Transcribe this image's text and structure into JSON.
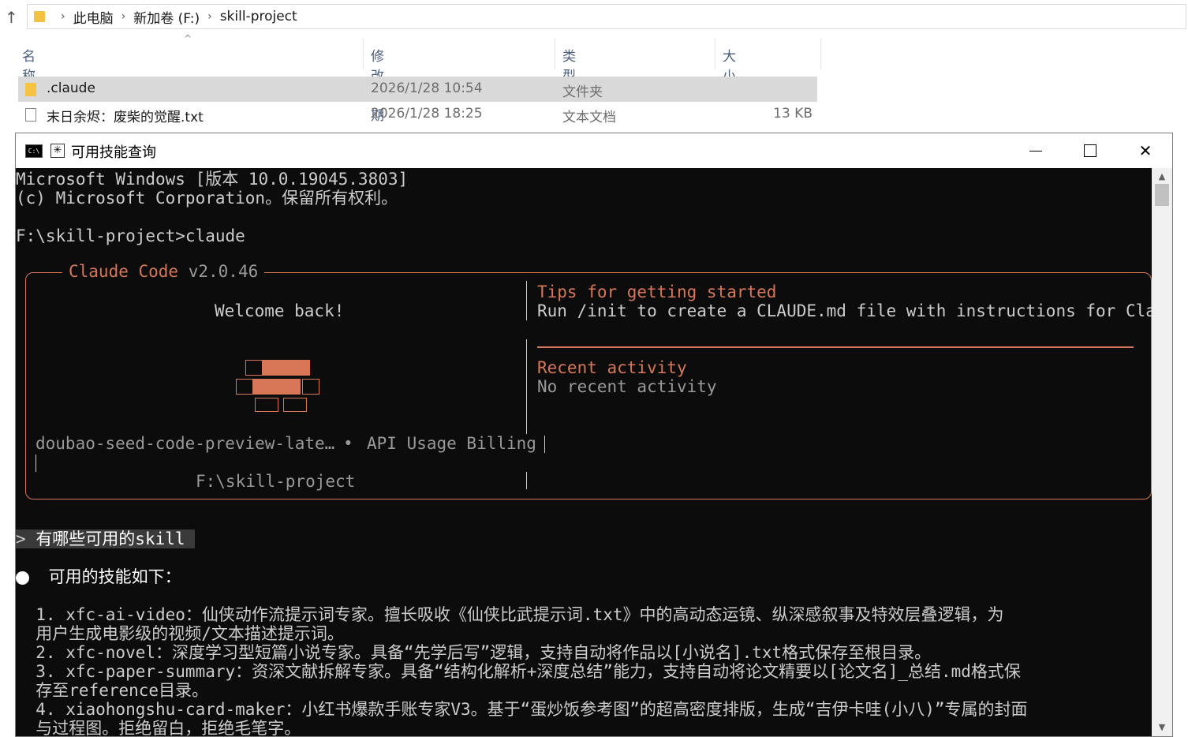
{
  "explorer": {
    "breadcrumb": [
      "此电脑",
      "新加卷 (F:)",
      "skill-project"
    ],
    "columns": {
      "name": "名称",
      "date": "修改日期",
      "type": "类型",
      "size": "大小"
    },
    "rows": [
      {
        "name": ".claude",
        "date": "2026/1/28 10:54",
        "type": "文件夹",
        "size": ""
      },
      {
        "name": "末日余烬：废柴的觉醒.txt",
        "date": "2026/1/28 18:25",
        "type": "文本文档",
        "size": "13 KB"
      }
    ]
  },
  "console": {
    "title": "可用技能查询",
    "lines": {
      "ms1": "Microsoft Windows [版本 10.0.19045.3803]",
      "ms2": "(c) Microsoft Corporation。保留所有权利。",
      "cmd": "F:\\skill-project>claude"
    },
    "panel": {
      "title": "Claude Code",
      "version": "v2.0.46",
      "welcome": "Welcome back!",
      "tips_title": "Tips for getting started",
      "tips_text": "Run /init to create a CLAUDE.md file with instructions for Cla…",
      "recent_title": "Recent activity",
      "recent_text": "No recent activity",
      "model": "doubao-seed-code-preview-late…",
      "dot": "•",
      "billing": "API Usage Billing",
      "cwd": "F:\\skill-project"
    },
    "prompt_marker": ">",
    "prompt": "有哪些可用的skill",
    "response_header": "可用的技能如下：",
    "skills": [
      "  1. xfc-ai-video：仙侠动作流提示词专家。擅长吸收《仙侠比武提示词.txt》中的高动态运镜、纵深感叙事及特效层叠逻辑，为",
      "  用户生成电影级的视频/文本描述提示词。",
      "  2. xfc-novel：深度学习型短篇小说专家。具备“先学后写”逻辑，支持自动将作品以[小说名].txt格式保存至根目录。",
      "  3. xfc-paper-summary：资深文献拆解专家。具备“结构化解析+深度总结”能力，支持自动将论文精要以[论文名]_总结.md格式保",
      "  存至reference目录。",
      "  4. xiaohongshu-card-maker：小红书爆款手账专家V3。基于“蛋炒饭参考图”的超高密度排版，生成“吉伊卡哇(小八)”专属的封面",
      "  与过程图。拒绝留白，拒绝毛笔字。"
    ]
  }
}
